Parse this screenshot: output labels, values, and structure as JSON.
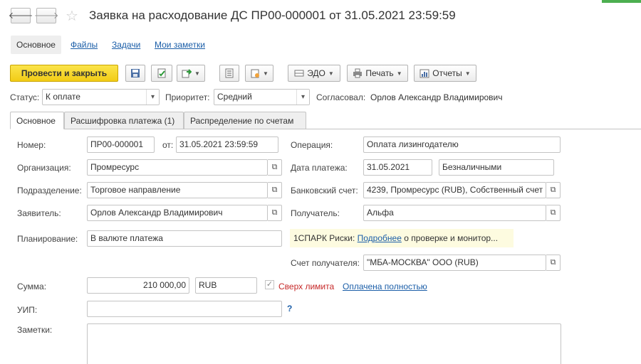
{
  "window": {
    "title": "Заявка на расходование ДС ПР00-000001 от 31.05.2021 23:59:59",
    "back_icon": "arrow-left-icon",
    "forward_icon": "arrow-right-icon",
    "favorite_icon": "star-icon"
  },
  "section_tabs": [
    "Основное",
    "Файлы",
    "Задачи",
    "Мои заметки"
  ],
  "toolbar": {
    "post_close": "Провести и закрыть",
    "edo": "ЭДО",
    "print": "Печать",
    "reports": "Отчеты"
  },
  "status_row": {
    "status_label": "Статус:",
    "status_value": "К оплате",
    "priority_label": "Приоритет:",
    "priority_value": "Средний",
    "approved_label": "Согласовал:",
    "approved_value": "Орлов Александр Владимирович"
  },
  "form_tabs": [
    "Основное",
    "Расшифровка платежа (1)",
    "Распределение по счетам"
  ],
  "form": {
    "number_label": "Номер:",
    "number_value": "ПР00-000001",
    "date_label": "от:",
    "date_value": "31.05.2021 23:59:59",
    "org_label": "Организация:",
    "org_value": "Промресурс",
    "dept_label": "Подразделение:",
    "dept_value": "Торговое направление",
    "applicant_label": "Заявитель:",
    "applicant_value": "Орлов Александр Владимирович",
    "planning_label": "Планирование:",
    "planning_value": "В валюте платежа",
    "operation_label": "Операция:",
    "operation_value": "Оплата лизингодателю",
    "paydate_label": "Дата платежа:",
    "paydate_value": "31.05.2021",
    "payform_value": "Безналичными",
    "bank_label": "Банковский счет:",
    "bank_value": "4239, Промресурс (RUB), Собственный счет",
    "recipient_label": "Получатель:",
    "recipient_value": "Альфа",
    "spark_prefix": "1СПАРК Риски:",
    "spark_link": "Подробнее",
    "spark_suffix": "о проверке и монитор...",
    "recipient_account_label": "Счет получателя:",
    "recipient_account_value": "\"МБА-МОСКВА\" ООО (RUB)",
    "sum_label": "Сумма:",
    "sum_value": "210 000,00",
    "currency_value": "RUB",
    "over_limit_label": "Сверх лимита",
    "paid_full_link": "Оплачена полностью",
    "uip_label": "УИП:",
    "uip_value": "",
    "uip_help": "?",
    "notes_label": "Заметки:"
  }
}
